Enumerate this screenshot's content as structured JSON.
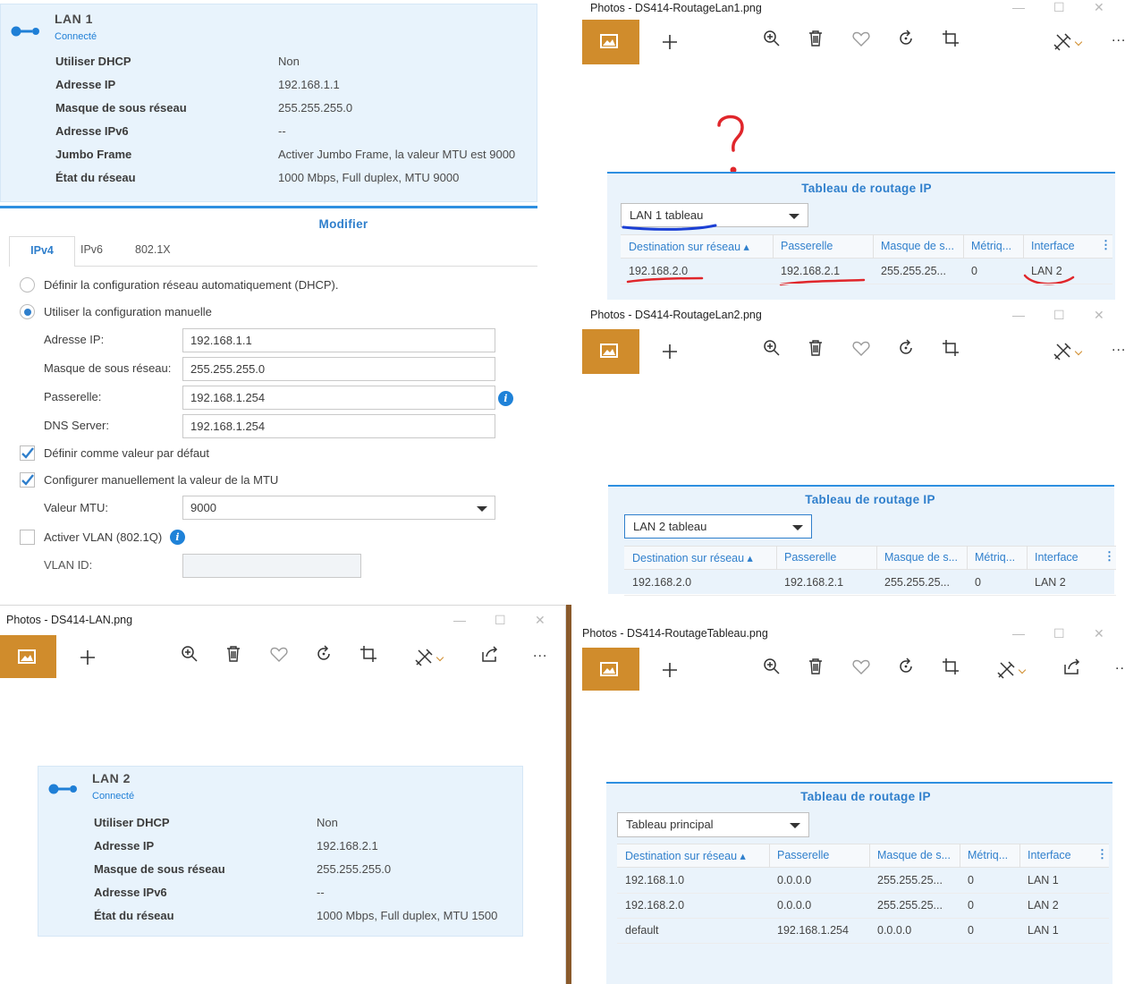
{
  "lan1": {
    "title": "LAN 1",
    "status": "Connecté",
    "rows": [
      {
        "label": "Utiliser DHCP",
        "value": "Non"
      },
      {
        "label": "Adresse IP",
        "value": "192.168.1.1"
      },
      {
        "label": "Masque de sous réseau",
        "value": "255.255.255.0"
      },
      {
        "label": "Adresse IPv6",
        "value": "--"
      },
      {
        "label": "Jumbo Frame",
        "value": "Activer Jumbo Frame, la valeur MTU est 9000"
      },
      {
        "label": "État du réseau",
        "value": "1000 Mbps, Full duplex, MTU 9000"
      }
    ]
  },
  "modifier": {
    "title": "Modifier",
    "tabs": [
      "IPv4",
      "IPv6",
      "802.1X"
    ],
    "radio_dhcp": "Définir la configuration réseau automatiquement (DHCP).",
    "radio_manual": "Utiliser la configuration manuelle",
    "fields": [
      {
        "label": "Adresse IP:",
        "value": "192.168.1.1"
      },
      {
        "label": "Masque de sous réseau:",
        "value": "255.255.255.0"
      },
      {
        "label": "Passerelle:",
        "value": "192.168.1.254"
      },
      {
        "label": "DNS Server:",
        "value": "192.168.1.254"
      }
    ],
    "check_default": "Définir comme valeur par défaut",
    "check_mtu": "Configurer manuellement la valeur de la MTU",
    "mtu_label": "Valeur MTU:",
    "mtu_value": "9000",
    "vlan_label": "Activer VLAN (802.1Q)",
    "vlan_id_label": "VLAN ID:",
    "vlan_id_value": ""
  },
  "win_lan": {
    "title": "Photos - DS414-LAN.png",
    "lan2": {
      "title": "LAN 2",
      "status": "Connecté",
      "rows": [
        {
          "label": "Utiliser DHCP",
          "value": "Non"
        },
        {
          "label": "Adresse IP",
          "value": "192.168.2.1"
        },
        {
          "label": "Masque de sous réseau",
          "value": "255.255.255.0"
        },
        {
          "label": "Adresse IPv6",
          "value": "--"
        },
        {
          "label": "État du réseau",
          "value": "1000 Mbps, Full duplex, MTU 1500"
        }
      ]
    }
  },
  "win_routage1": {
    "title": "Photos - DS414-RoutageLan1.png",
    "table_title": "Tableau de routage IP",
    "select": "LAN 1 tableau",
    "annotation": "?",
    "headers": [
      "Destination sur réseau ▴",
      "Passerelle",
      "Masque de s...",
      "Métriq...",
      "Interface"
    ],
    "rows": [
      [
        "192.168.2.0",
        "192.168.2.1",
        "255.255.25...",
        "0",
        "LAN 2"
      ]
    ]
  },
  "win_routage2": {
    "title": "Photos - DS414-RoutageLan2.png",
    "table_title": "Tableau de routage IP",
    "select": "LAN 2 tableau",
    "headers": [
      "Destination sur réseau ▴",
      "Passerelle",
      "Masque de s...",
      "Métriq...",
      "Interface"
    ],
    "rows": [
      [
        "192.168.2.0",
        "192.168.2.1",
        "255.255.25...",
        "0",
        "LAN 2"
      ]
    ]
  },
  "win_tableau": {
    "title": "Photos - DS414-RoutageTableau.png",
    "table_title": "Tableau de routage IP",
    "select": "Tableau principal",
    "headers": [
      "Destination sur réseau ▴",
      "Passerelle",
      "Masque de s...",
      "Métriq...",
      "Interface"
    ],
    "rows": [
      [
        "192.168.1.0",
        "0.0.0.0",
        "255.255.25...",
        "0",
        "LAN 1"
      ],
      [
        "192.168.2.0",
        "0.0.0.0",
        "255.255.25...",
        "0",
        "LAN 2"
      ],
      [
        "default",
        "192.168.1.254",
        "0.0.0.0",
        "0",
        "LAN 1"
      ]
    ]
  },
  "toolbar": {
    "more": "...",
    "win_min": "—",
    "win_max": "☐",
    "win_close": "✕"
  },
  "colors": {
    "accent": "#2f7fcc",
    "photo_tile": "#d08c2c",
    "annotation_red": "#e0262b"
  }
}
